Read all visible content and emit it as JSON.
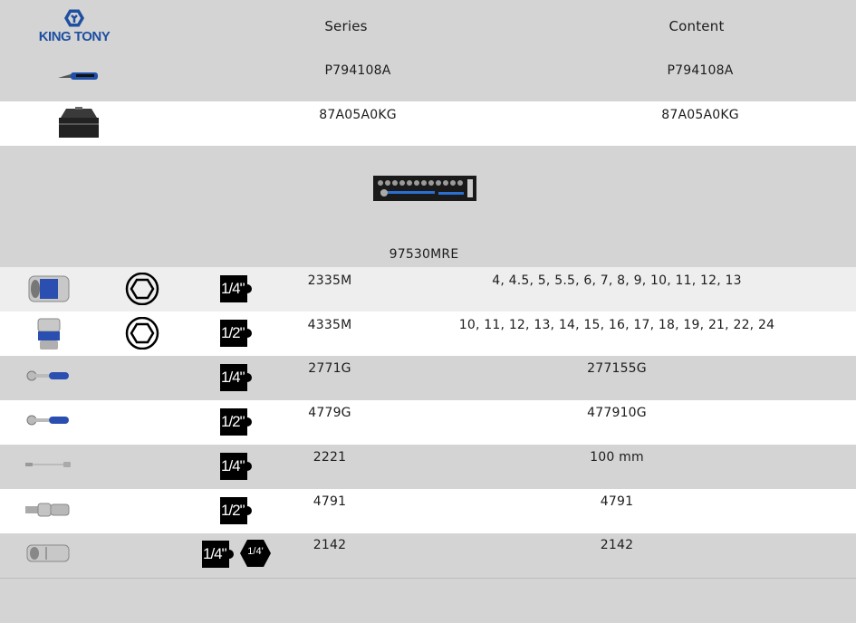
{
  "header": {
    "logo_text": "KING TONY",
    "series_label": "Series",
    "content_label": "Content"
  },
  "top_rows": [
    {
      "icon": "utility-knife-icon",
      "series": "P794108A",
      "content": "P794108A"
    },
    {
      "icon": "toolbox-icon",
      "series": "87A05A0KG",
      "content": "87A05A0KG"
    }
  ],
  "set": {
    "icon": "tool-tray-icon",
    "code": "97530MRE"
  },
  "items": [
    {
      "icon": "socket-icon",
      "shape": "hexagon-icon",
      "drive": "1/4\"",
      "series": "2335M",
      "content": "4, 4.5, 5, 5.5, 6, 7, 8, 9, 10, 11, 12, 13"
    },
    {
      "icon": "socket-icon",
      "shape": "hexagon-icon",
      "drive": "1/2\"",
      "series": "4335M",
      "content": "10, 11, 12, 13, 14, 15, 16, 17, 18, 19, 21, 22, 24"
    },
    {
      "icon": "ratchet-icon",
      "drive": "1/4\"",
      "series": "2771G",
      "content": "277155G"
    },
    {
      "icon": "ratchet-icon",
      "drive": "1/2\"",
      "series": "4779G",
      "content": "477910G"
    },
    {
      "icon": "extension-bar-icon",
      "drive": "1/4\"",
      "series": "2221",
      "content": "100 mm"
    },
    {
      "icon": "universal-joint-icon",
      "drive": "1/2\"",
      "series": "4791",
      "content": "4791"
    },
    {
      "icon": "bit-adapter-icon",
      "drive": "1/4\"",
      "hex_drive": "1/4'",
      "series": "2142",
      "content": "2142"
    }
  ],
  "colors": {
    "gray": "#d4d4d4",
    "white": "#ffffff",
    "brand_blue": "#1e4fa0"
  }
}
